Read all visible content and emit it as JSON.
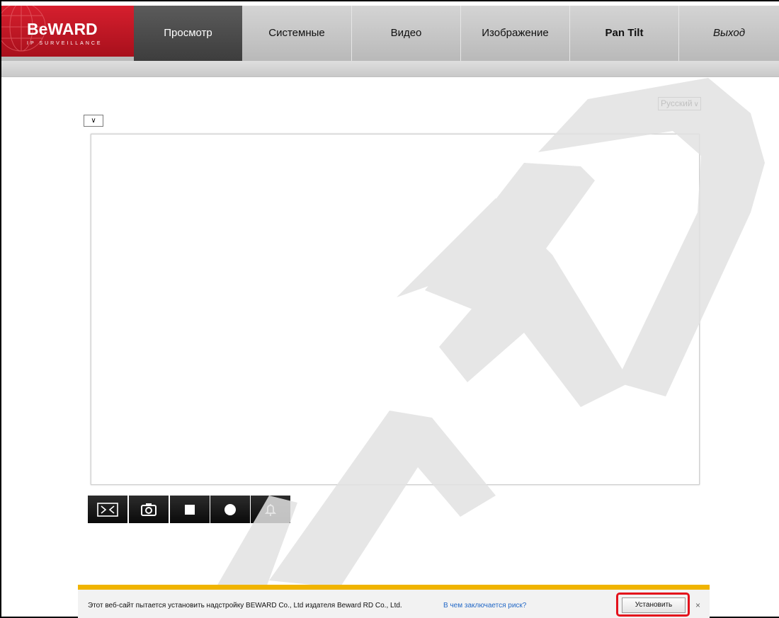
{
  "brand": {
    "name": "BeWARD",
    "tagline": "IP SURVEILLANCE",
    "color": "#c4161c"
  },
  "nav": {
    "tabs": [
      {
        "label": "Просмотр",
        "active": true
      },
      {
        "label": "Системные"
      },
      {
        "label": "Видео"
      },
      {
        "label": "Изображение"
      },
      {
        "label": "Pan Tilt"
      },
      {
        "label": "Выход"
      }
    ]
  },
  "language_select": {
    "value": "Русский"
  },
  "stream_select": {
    "value": ""
  },
  "controls": [
    {
      "icon": "fullscreen-icon"
    },
    {
      "icon": "camera-snapshot-icon"
    },
    {
      "icon": "stop-icon"
    },
    {
      "icon": "record-icon"
    },
    {
      "icon": "alarm-bell-icon"
    }
  ],
  "infobar": {
    "message": "Этот веб-сайт пытается установить надстройку BEWARD Co., Ltd издателя Beward RD Co., Ltd.",
    "link": "В чем заключается риск?",
    "install": "Установить",
    "close": "×",
    "accent": "#f0b400"
  }
}
